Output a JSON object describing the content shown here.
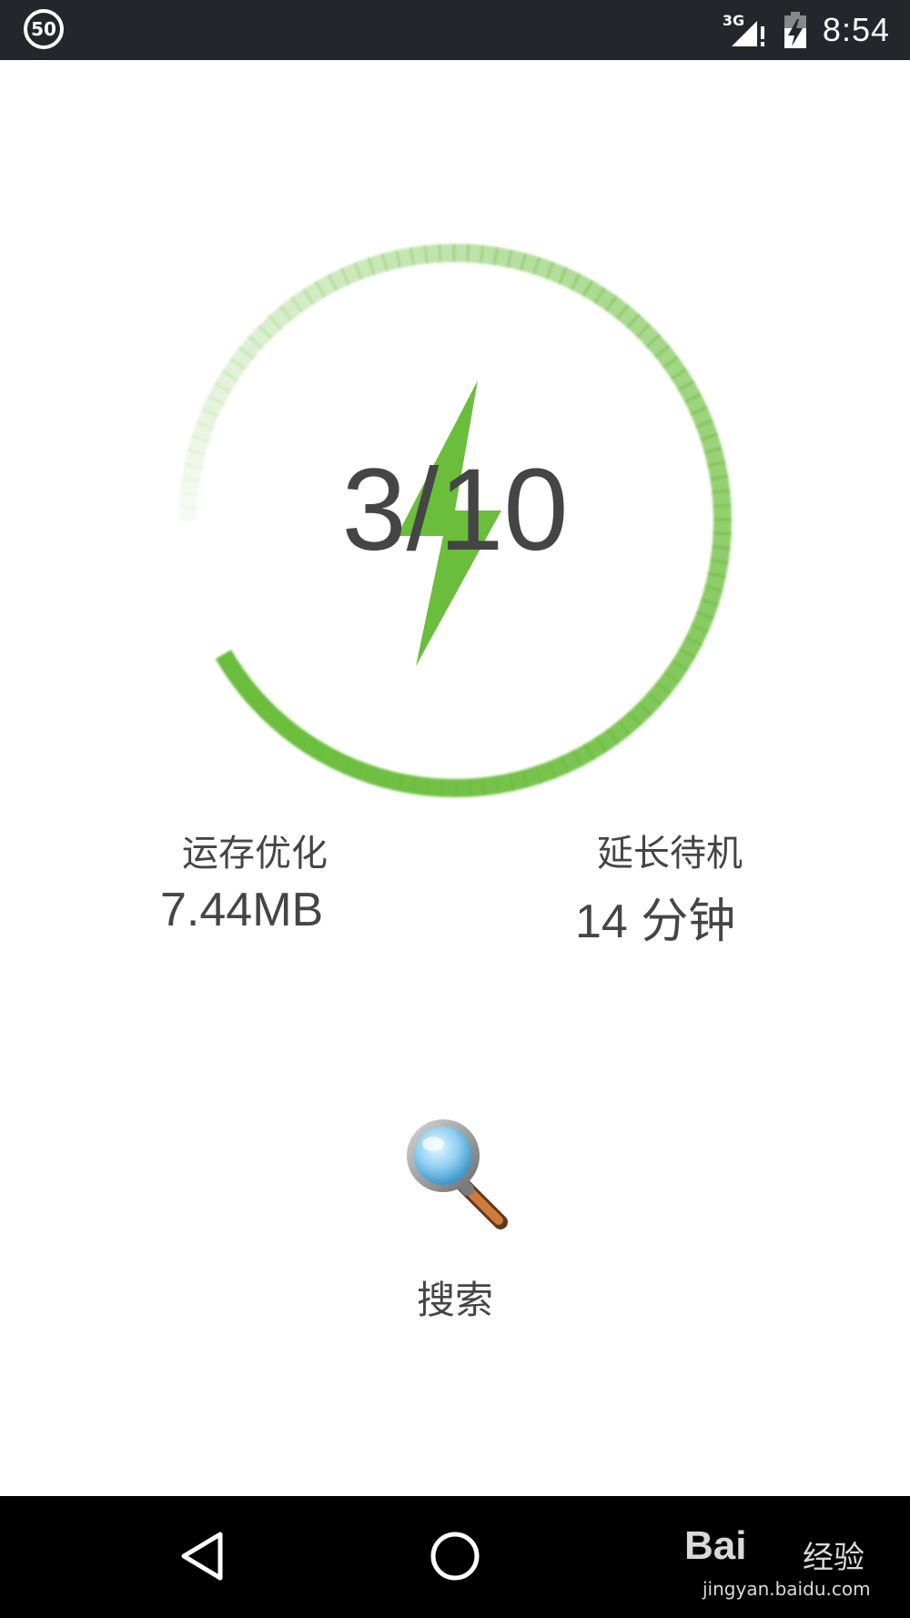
{
  "status_bar": {
    "speed_badge": "50",
    "network_type": "3G",
    "time": "8:54"
  },
  "score": {
    "text": "3/10",
    "value": 3,
    "max": 10
  },
  "stats": {
    "memory": {
      "label": "运存优化",
      "value": "7.44MB"
    },
    "standby": {
      "label": "延长待机",
      "value": "14 分钟"
    }
  },
  "search": {
    "label": "搜索"
  },
  "nav": {
    "back": "back-icon",
    "home": "home-icon"
  },
  "watermark": {
    "logo": "Bai",
    "tag": "经验",
    "url": "jingyan.baidu.com"
  },
  "colors": {
    "accent": "#6bbd3c",
    "text": "#454545",
    "status_bar": "#23272b",
    "nav_bar": "#000000"
  }
}
